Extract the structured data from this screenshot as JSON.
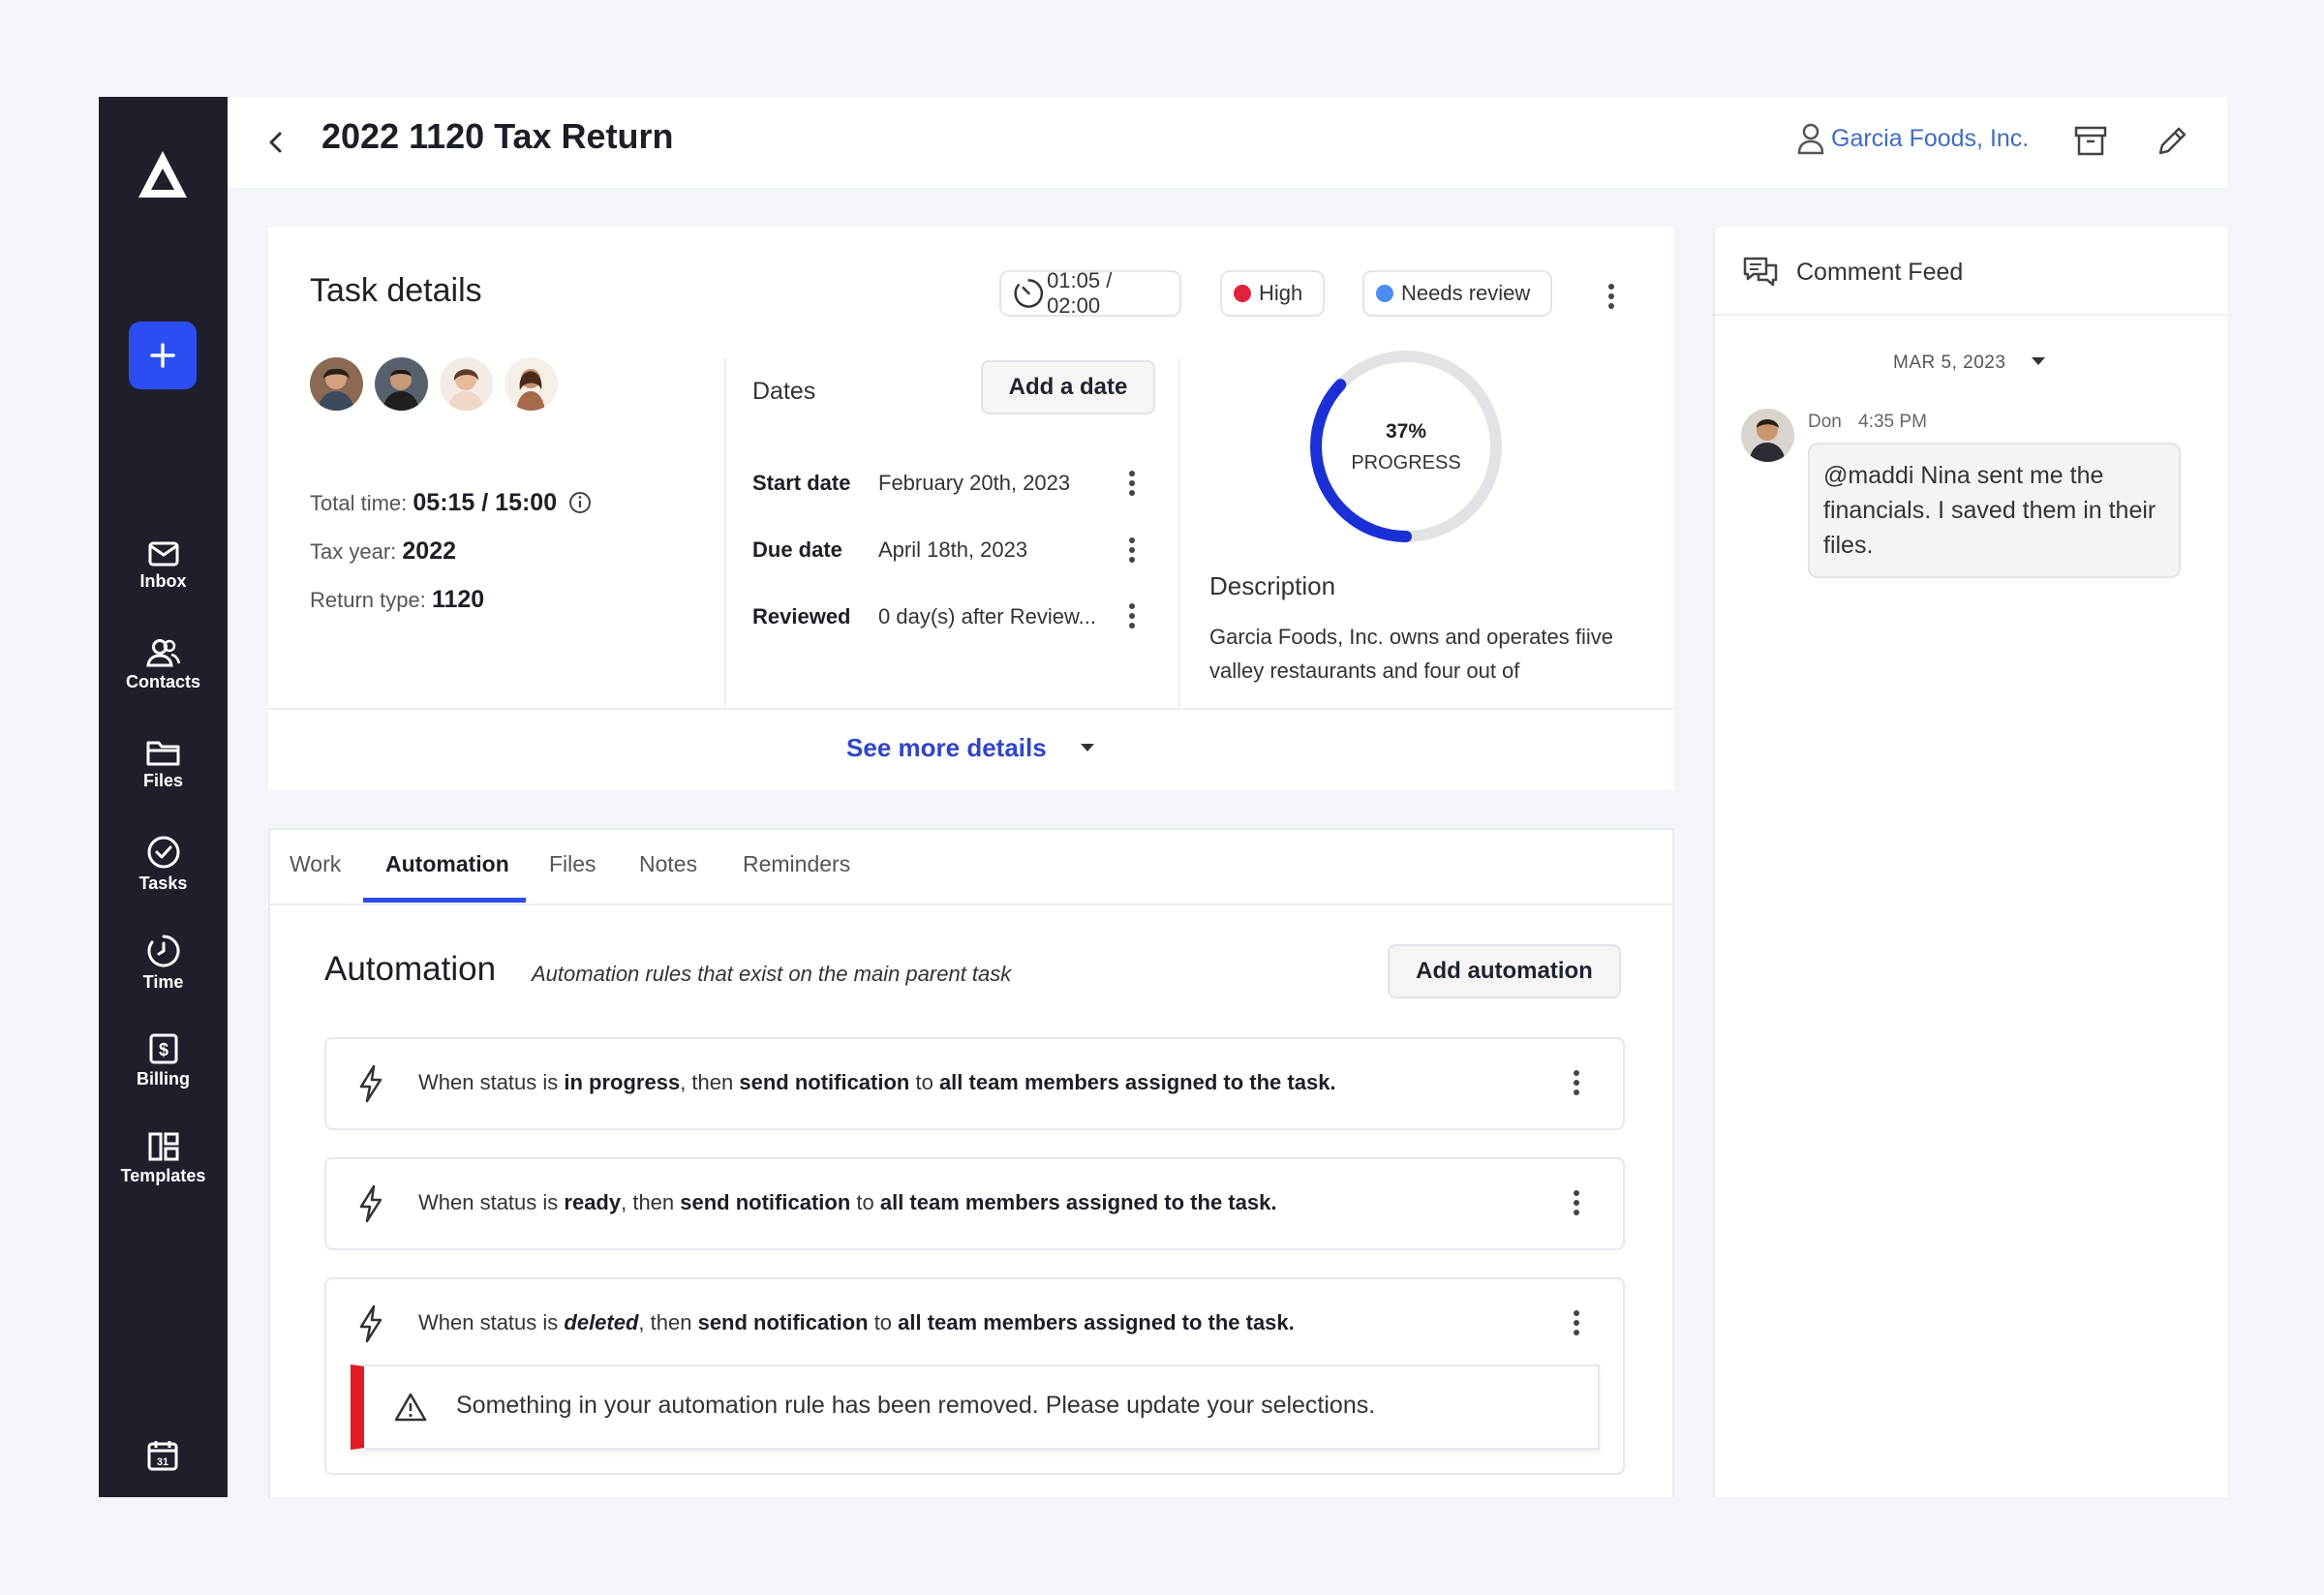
{
  "header": {
    "title": "2022 1120 Tax Return",
    "client": "Garcia Foods, Inc."
  },
  "sidebar": {
    "items": [
      {
        "label": "Inbox",
        "icon": "mail-icon"
      },
      {
        "label": "Contacts",
        "icon": "contacts-icon"
      },
      {
        "label": "Files",
        "icon": "folder-icon"
      },
      {
        "label": "Tasks",
        "icon": "check-circle-icon"
      },
      {
        "label": "Time",
        "icon": "clock-icon"
      },
      {
        "label": "Billing",
        "icon": "billing-icon"
      },
      {
        "label": "Templates",
        "icon": "templates-icon"
      }
    ]
  },
  "task": {
    "heading": "Task details",
    "timer": "01:05 / 02:00",
    "priority": "High",
    "status": "Needs review",
    "total_time_label": "Total time:",
    "total_time_value": "05:15 / 15:00",
    "tax_year_label": "Tax year:",
    "tax_year_value": "2022",
    "return_type_label": "Return type:",
    "return_type_value": "1120",
    "dates_label": "Dates",
    "add_date_label": "Add a date",
    "dates": [
      {
        "label": "Start date",
        "value": "February 20th, 2023"
      },
      {
        "label": "Due date",
        "value": "April 18th, 2023"
      },
      {
        "label": "Reviewed",
        "value": "0 day(s) after Review..."
      }
    ],
    "progress_percent": 37,
    "progress_text": "37%",
    "progress_label": "PROGRESS",
    "description_label": "Description",
    "description": "Garcia Foods, Inc. owns and operates fiive valley restaurants and four out of",
    "see_more": "See more details"
  },
  "tabs": [
    "Work",
    "Automation",
    "Files",
    "Notes",
    "Reminders"
  ],
  "automation": {
    "title": "Automation",
    "subtitle": "Automation rules that exist on the main parent task",
    "add_label": "Add automation",
    "rules": [
      {
        "prefix": "When status is ",
        "status": "in progress",
        "mid": ", then ",
        "action": "send notification",
        "to": " to ",
        "target": "all team members assigned to the task."
      },
      {
        "prefix": "When status is ",
        "status": "ready",
        "mid": ", then ",
        "action": "send notification",
        "to": " to ",
        "target": "all team members assigned to the task."
      },
      {
        "prefix": "When status is ",
        "status": "deleted",
        "mid": ", then ",
        "action": "send notification",
        "to": " to ",
        "target": "all team members assigned to the task."
      }
    ],
    "warning": "Something in your automation rule has been removed. Please update your selections."
  },
  "feed": {
    "title": "Comment Feed",
    "date": "MAR 5, 2023",
    "comment_author": "Don",
    "comment_time": "4:35 PM",
    "comment_text": "@maddi Nina sent me the financials. I saved them in their files."
  },
  "colors": {
    "accent": "#2b4ef2",
    "sidebar": "#1f1f2b",
    "high": "#e0233a",
    "needs_review": "#4a8cf0",
    "link": "#2f45c9",
    "error": "#e01b24"
  }
}
